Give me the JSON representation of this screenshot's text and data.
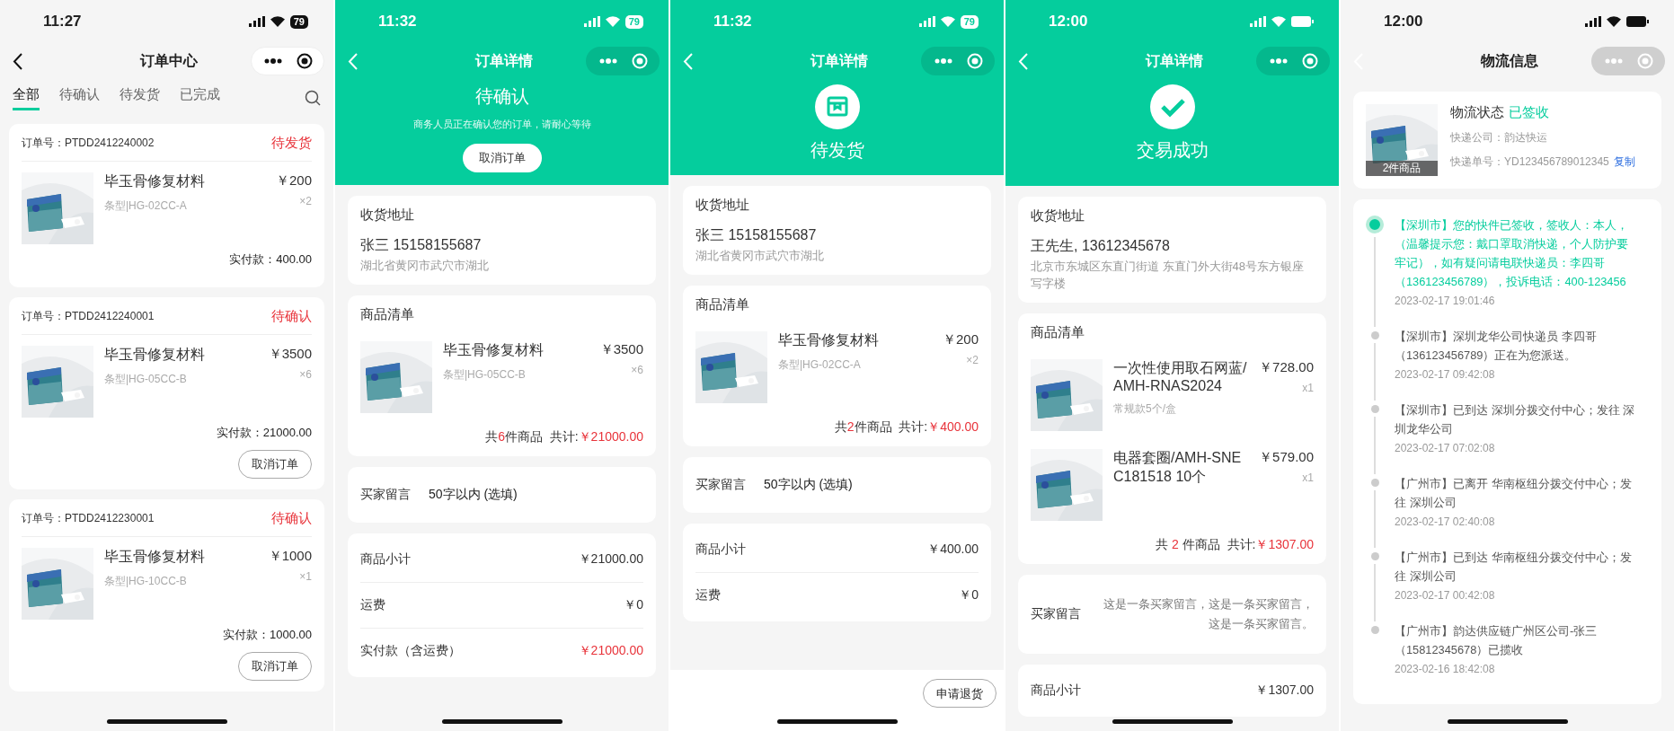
{
  "screens": [
    {
      "kind": "order_list",
      "status_bar": {
        "time": "11:27",
        "battery": "79"
      },
      "nav": {
        "title": "订单中心"
      },
      "tabs": [
        {
          "label": "全部",
          "selected": true
        },
        {
          "label": "待确认",
          "selected": false
        },
        {
          "label": "待发货",
          "selected": false
        },
        {
          "label": "已完成",
          "selected": false
        }
      ],
      "orders": [
        {
          "order_no": "订单号：PTDD2412240002",
          "status": "待发货",
          "product": {
            "name": "毕玉骨修复材料",
            "spec": "条型|HG-02CC-A",
            "price": "￥200",
            "qty": "×2"
          },
          "paid": "实付款：400.00"
        },
        {
          "order_no": "订单号：PTDD2412240001",
          "status": "待确认",
          "product": {
            "name": "毕玉骨修复材料",
            "spec": "条型|HG-05CC-B",
            "price": "￥3500",
            "qty": "×6"
          },
          "paid": "实付款：21000.00",
          "button": "取消订单"
        },
        {
          "order_no": "订单号：PTDD2412230001",
          "status": "待确认",
          "product": {
            "name": "毕玉骨修复材料",
            "spec": "条型|HG-10CC-B",
            "price": "￥1000",
            "qty": "×1"
          },
          "paid": "实付款：1000.00",
          "button": "取消订单"
        }
      ]
    },
    {
      "kind": "detail",
      "status_bar": {
        "time": "11:32",
        "battery": "79"
      },
      "nav": {
        "title": "订单详情"
      },
      "header": {
        "kind": "notice",
        "title": "待确认",
        "subtitle": "商务人员正在确认您的订单，请耐心等待",
        "button": "取消订单"
      },
      "address": {
        "title": "收货地址",
        "contact": "张三  15158155687",
        "address": "湖北省黄冈市武穴市湖北"
      },
      "goods": {
        "title": "商品清单",
        "items": [
          {
            "name": "毕玉骨修复材料",
            "spec": "条型|HG-05CC-B",
            "price": "￥3500",
            "qty": "×6"
          }
        ],
        "count_prefix": "共",
        "count": "6",
        "count_suffix": "件商品",
        "total_label": "共计:",
        "total": "￥21000.00"
      },
      "message": {
        "label": "买家留言",
        "placeholder": "50字以内 (选填)"
      },
      "summary": [
        {
          "label": "商品小计",
          "value": "￥21000.00",
          "highlight": false
        },
        {
          "label": "运费",
          "value": "￥0",
          "highlight": false
        },
        {
          "label": "实付款（含运费）",
          "value": "￥21000.00",
          "highlight": true
        }
      ]
    },
    {
      "kind": "detail",
      "status_bar": {
        "time": "11:32",
        "battery": "79"
      },
      "nav": {
        "title": "订单详情"
      },
      "header": {
        "kind": "shipping",
        "title": "待发货"
      },
      "address": {
        "title": "收货地址",
        "contact": "张三  15158155687",
        "address": "湖北省黄冈市武穴市湖北"
      },
      "goods": {
        "title": "商品清单",
        "items": [
          {
            "name": "毕玉骨修复材料",
            "spec": "条型|HG-02CC-A",
            "price": "￥200",
            "qty": "×2"
          }
        ],
        "count_prefix": "共",
        "count": "2",
        "count_suffix": "件商品",
        "total_label": "共计:",
        "total": "￥400.00"
      },
      "message": {
        "label": "买家留言",
        "placeholder": "50字以内 (选填)"
      },
      "summary": [
        {
          "label": "商品小计",
          "value": "￥400.00",
          "highlight": false
        },
        {
          "label": "运费",
          "value": "￥0",
          "highlight": false
        }
      ],
      "bottom_bar": {
        "button": "申请退货"
      }
    },
    {
      "kind": "detail",
      "status_bar": {
        "time": "12:00"
      },
      "nav": {
        "title": "订单详情"
      },
      "header": {
        "kind": "success",
        "title": "交易成功"
      },
      "address": {
        "title": "收货地址",
        "contact": "王先生, 13612345678",
        "address": "北京市东城区东直门街道 东直门外大街48号东方银座写字楼"
      },
      "goods": {
        "title": "商品清单",
        "items": [
          {
            "name": "一次性使用取石网蓝/AMH-RNAS2024",
            "spec": "常规款5个/盒",
            "price": "￥728.00",
            "qty": "x1"
          },
          {
            "name": "电器套圈/AMH-SNEC181518 10个",
            "price": "￥579.00",
            "qty": "x1"
          }
        ],
        "count_prefix": "共 ",
        "count": "2",
        "count_suffix": " 件商品",
        "total_label": "共计:",
        "total": "￥1307.00"
      },
      "message": {
        "label": "买家留言",
        "value": "这是一条买家留言，这是一条买家留言，这是一条买家留言。"
      },
      "summary": [
        {
          "label": "商品小计",
          "value": "￥1307.00",
          "highlight": false
        }
      ]
    },
    {
      "kind": "logistics",
      "status_bar": {
        "time": "12:00"
      },
      "nav": {
        "title": "物流信息"
      },
      "shipment": {
        "item_count": "2件商品",
        "status_label": "物流状态",
        "status": "已签收",
        "company": "快递公司：韵达快运",
        "tracking_no": "快递单号：YD123456789012345",
        "copy": "复制"
      },
      "events": [
        {
          "text": "【深圳市】您的快件已签收，签收人：本人，（温馨提示您：戴口罩取消快递，个人防护要牢记），如有疑问请电联快递员：李四哥（136123456789），投诉电话：400-123456",
          "time": "2023-02-17 19:01:46",
          "current": true
        },
        {
          "text": "【深圳市】深圳龙华公司快递员 李四哥（136123456789）正在为您派送。",
          "time": "2023-02-17 09:42:08",
          "current": false
        },
        {
          "text": "【深圳市】已到达 深圳分拨交付中心；发往 深圳龙华公司",
          "time": "2023-02-17 07:02:08",
          "current": false
        },
        {
          "text": "【广州市】已离开 华南枢纽分拨交付中心；发往 深圳公司",
          "time": "2023-02-17 02:40:08",
          "current": false
        },
        {
          "text": "【广州市】已到达 华南枢纽分拨交付中心；发往 深圳公司",
          "time": "2023-02-17 00:42:08",
          "current": false
        },
        {
          "text": "【广州市】韵达供应链广州区公司-张三（15812345678）已揽收",
          "time": "2023-02-16 18:42:08",
          "current": false
        }
      ]
    }
  ]
}
